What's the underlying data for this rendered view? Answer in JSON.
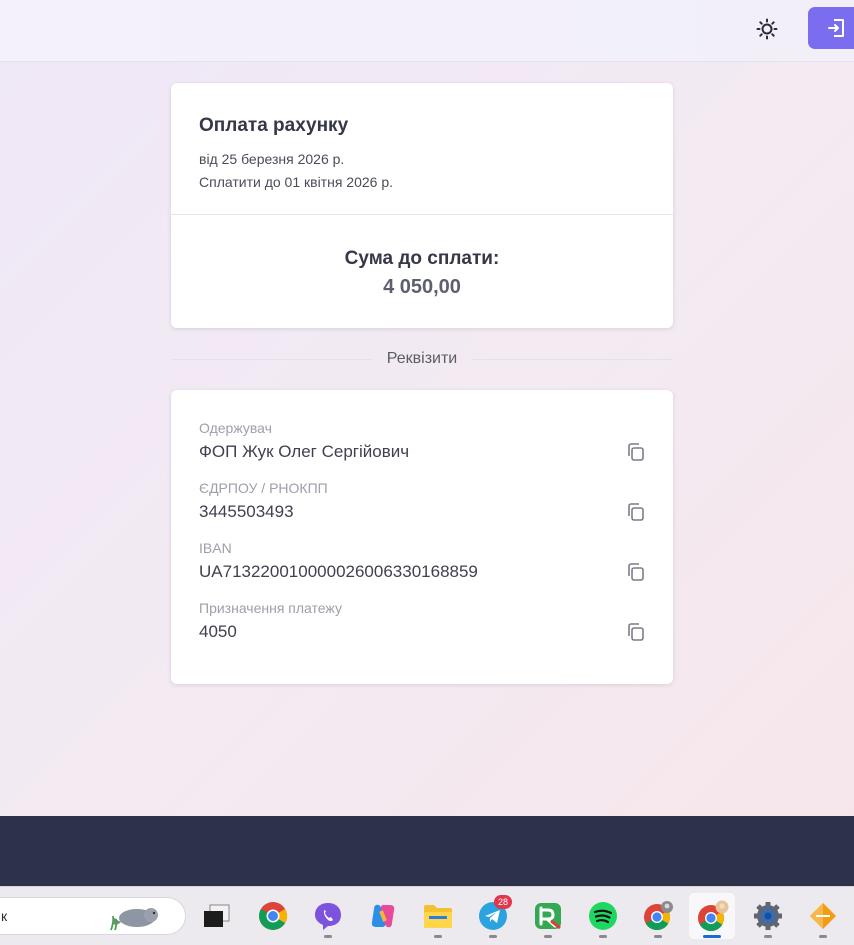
{
  "header": {
    "theme_toggle_icon": "sun-icon",
    "logout_icon": "logout-icon",
    "accent_color": "#7b6df0"
  },
  "invoice": {
    "title": "Оплата рахунку",
    "date_line": "від 25 березня 2026 р.",
    "due_line": "Сплатити до 01 квітня 2026 р.",
    "sum_label": "Сума до сплати:",
    "sum_value": "4 050,00"
  },
  "requisites": {
    "section_title": "Реквізити",
    "copy_icon": "copy-icon",
    "rows": [
      {
        "label": "Одержувач",
        "value": "ФОП Жук Олег Сергійович"
      },
      {
        "label": "ЄДРПОУ / РНОКПП",
        "value": "3445503493"
      },
      {
        "label": "IBAN",
        "value": "UA713220010000026006330168859"
      },
      {
        "label": "Призначення платежу",
        "value": "4050"
      }
    ]
  },
  "taskbar": {
    "search_text": "к",
    "telegram_badge": "28",
    "apps": [
      "task-view-icon",
      "chrome-icon",
      "viber-icon",
      "copilot-icon",
      "file-explorer-icon",
      "telegram-icon",
      "app-icon",
      "spotify-icon",
      "chrome-profile-icon",
      "chrome-active-icon",
      "settings-icon",
      "app-orange-icon"
    ]
  }
}
